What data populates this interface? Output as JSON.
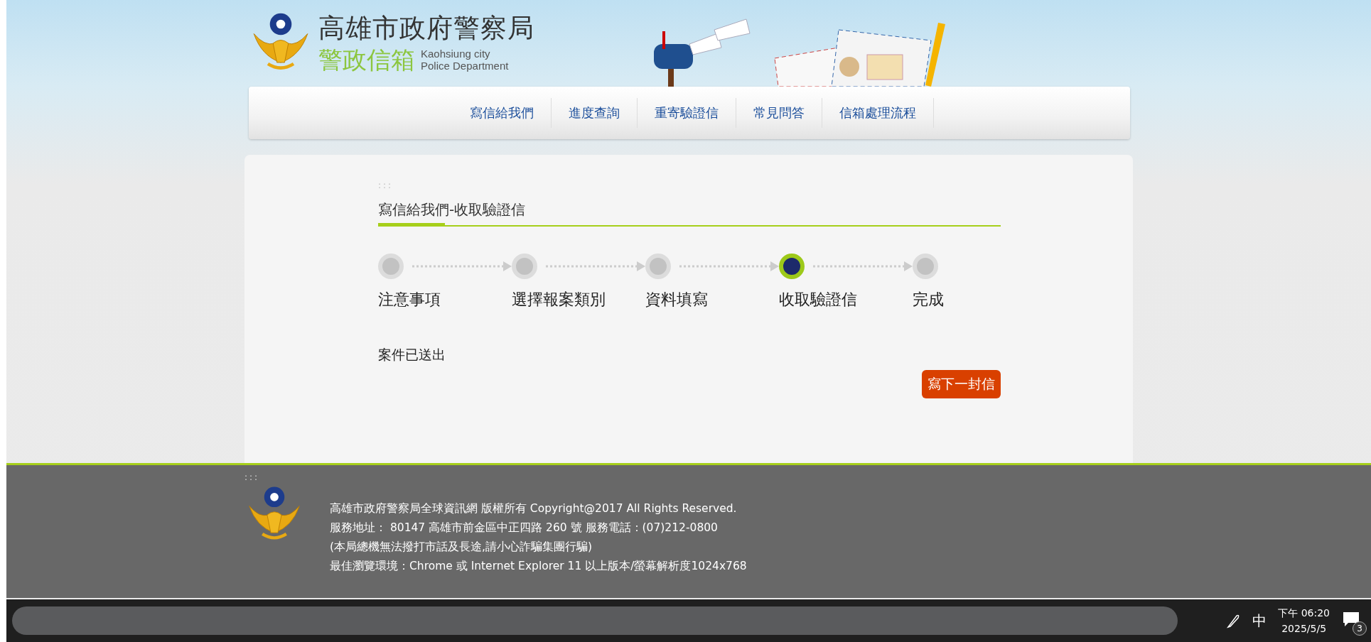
{
  "header": {
    "title": "高雄市政府警察局",
    "subtitle": "警政信箱",
    "english_line_1": "Kaohsiung city",
    "english_line_2": "Police Department"
  },
  "nav": [
    {
      "label": "寫信給我們",
      "selected": false
    },
    {
      "label": "進度查詢",
      "selected": false
    },
    {
      "label": "重寄驗證信",
      "selected": false
    },
    {
      "label": "常見問答",
      "selected": false
    },
    {
      "label": "信箱處理流程",
      "selected": false
    }
  ],
  "content": {
    "accesskey": ":::",
    "title": "寫信給我們-收取驗證信",
    "steps": [
      {
        "label": "注意事項",
        "selected": false
      },
      {
        "label": "選擇報案類別",
        "selected": false
      },
      {
        "label": "資料填寫",
        "selected": false
      },
      {
        "label": "收取驗證信",
        "selected": true
      },
      {
        "label": "完成",
        "selected": false
      }
    ],
    "message": "案件已送出",
    "button": "寫下一封信"
  },
  "footer": {
    "accesskey": ":::",
    "lines": [
      "高雄市政府警察局全球資訊網 版權所有 Copyright@2017 All Rights Reserved.",
      "服務地址： 80147 高雄市前金區中正四路 260 號 服務電話：(07)212-0800",
      "(本局總機無法撥打市話及長途,請小心詐騙集團行騙)",
      "最佳瀏覽環境：Chrome 或 Internet Explorer 11 以上版本/螢幕解析度1024x768"
    ]
  },
  "taskbar": {
    "ime": "中",
    "time": "下午 06:20",
    "date": "2025/5/5",
    "notifications": "3"
  }
}
